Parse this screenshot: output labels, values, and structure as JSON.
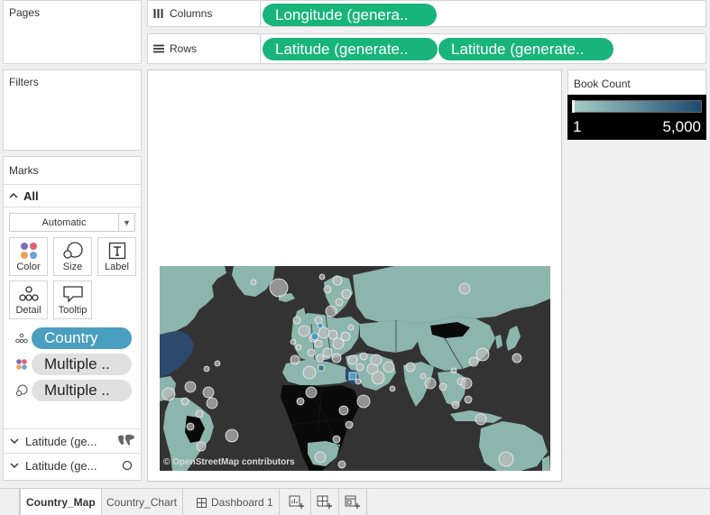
{
  "cards": {
    "pages": {
      "title": "Pages"
    },
    "filters": {
      "title": "Filters"
    },
    "marks": {
      "title": "Marks",
      "all_label": "All",
      "type_dropdown": "Automatic"
    }
  },
  "shelves": {
    "columns": {
      "label": "Columns",
      "pills": [
        "Longitude (genera.."
      ]
    },
    "rows": {
      "label": "Rows",
      "pills": [
        "Latitude (generate..",
        "Latitude (generate.."
      ]
    }
  },
  "mark_buttons": [
    {
      "label": "Color",
      "icon": "color-dots-icon"
    },
    {
      "label": "Size",
      "icon": "size-circles-icon"
    },
    {
      "label": "Label",
      "icon": "label-t-icon"
    },
    {
      "label": "Detail",
      "icon": "detail-dots-icon"
    },
    {
      "label": "Tooltip",
      "icon": "tooltip-speech-icon"
    }
  ],
  "mark_fields": [
    {
      "label": "Country",
      "icon": "detail-dots-icon",
      "bg": "#4a9fc0",
      "fg": "#ffffff"
    },
    {
      "label": "Multiple ..",
      "icon": "color-dots-icon",
      "bg": "#e0e0e0",
      "fg": "#222222"
    },
    {
      "label": "Multiple ..",
      "icon": "size-circles-icon",
      "bg": "#e0e0e0",
      "fg": "#222222"
    }
  ],
  "latitude_layers": [
    {
      "label": "Latitude (ge...",
      "icon": "map-icon"
    },
    {
      "label": "Latitude (ge...",
      "icon": "circle-icon"
    }
  ],
  "legend": {
    "title": "Book Count",
    "min_label": "1",
    "max_label": "5,000",
    "color_low": "#a6cfc7",
    "color_high": "#1f4a72"
  },
  "map": {
    "attribution": "© OpenStreetMap contributors",
    "land_color": "#8cb5ad",
    "ocean_color": "#333333",
    "dark_land_color": "#0a0a0a",
    "highlight_color": "#2b4a6e"
  },
  "tabs": [
    {
      "label": "Country_Map",
      "active": true
    },
    {
      "label": "Country_Chart",
      "active": false
    },
    {
      "label": "Dashboard 1",
      "active": false,
      "icon": "dashboard-grid-icon"
    }
  ],
  "tab_actions": [
    {
      "icon": "new-worksheet-icon"
    },
    {
      "icon": "new-dashboard-icon"
    },
    {
      "icon": "new-story-icon"
    }
  ]
}
